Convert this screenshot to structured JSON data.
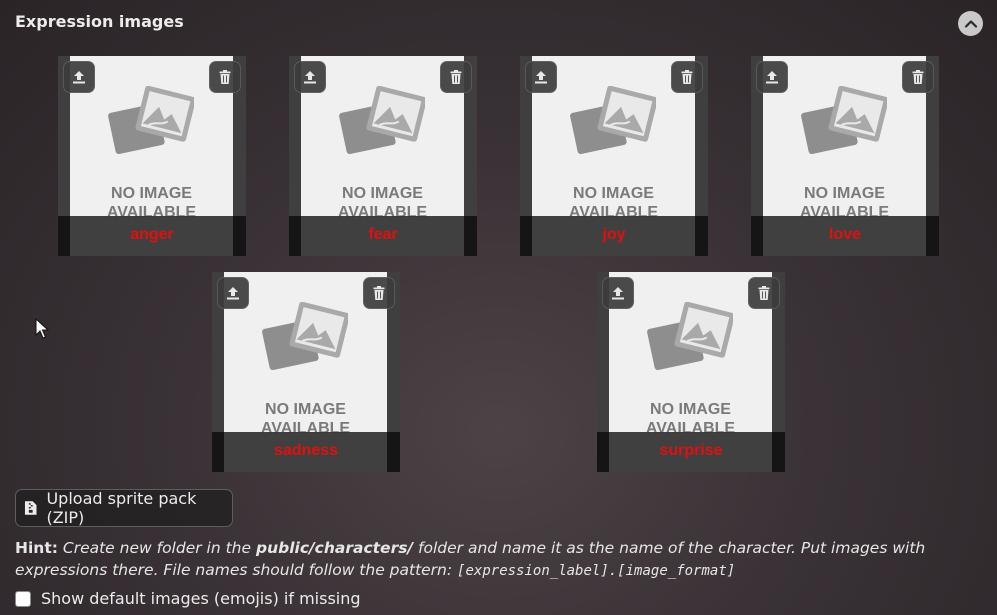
{
  "section": {
    "title": "Expression images"
  },
  "expressions": [
    {
      "label": "anger"
    },
    {
      "label": "fear"
    },
    {
      "label": "joy"
    },
    {
      "label": "love"
    },
    {
      "label": "sadness"
    },
    {
      "label": "surprise"
    }
  ],
  "placeholder": {
    "line1": "NO IMAGE",
    "line2": "AVAILABLE"
  },
  "upload": {
    "label": "Upload sprite pack (ZIP)"
  },
  "hint": {
    "prefix": "Hint:",
    "text1": "Create new folder in the",
    "folder": "public/characters/",
    "text2": "folder and name it as the name of the character. Put images with expressions there. File names should follow the pattern:",
    "pattern": "[expression_label].[image_format]"
  },
  "show_default": {
    "label": "Show default images (emojis) if missing",
    "checked": false
  },
  "colors": {
    "label_red": "#e01010",
    "placeholder_bg": "#f0f0f0"
  }
}
